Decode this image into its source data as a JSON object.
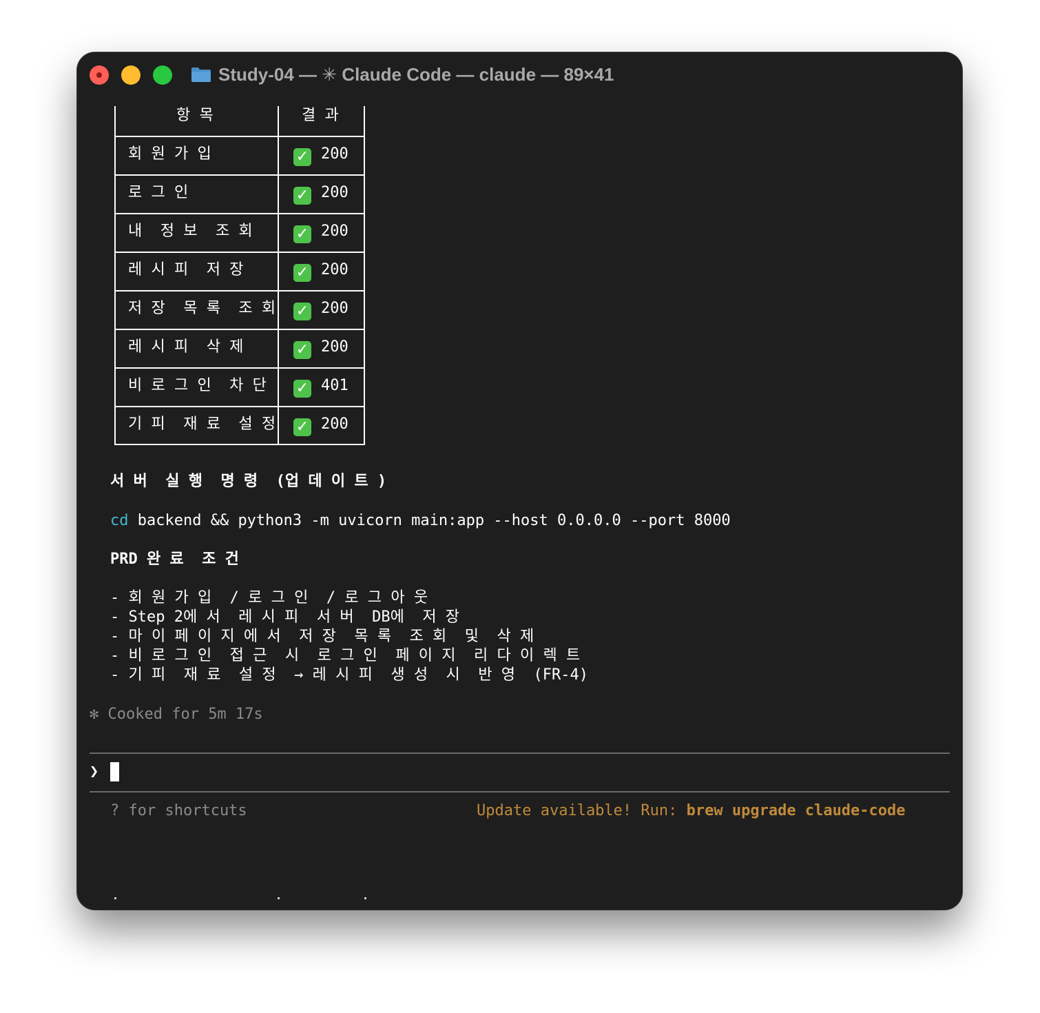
{
  "window": {
    "title_folder": "Study-04",
    "title_sep1": " — ",
    "title_spark": "✳",
    "title_app": " Claude Code",
    "title_sep2": " — ",
    "title_cmd": "claude",
    "title_sep3": " — ",
    "title_size": "89×41"
  },
  "table": {
    "headers": [
      "항 목",
      "결 과"
    ],
    "rows": [
      {
        "item": "회 원 가 입",
        "result": "200"
      },
      {
        "item": "로 그 인",
        "result": "200"
      },
      {
        "item": "내  정 보  조 회",
        "result": "200"
      },
      {
        "item": "레 시 피  저 장",
        "result": "200"
      },
      {
        "item": "저 장  목 록  조 회",
        "result": "200"
      },
      {
        "item": "레 시 피  삭 제",
        "result": "200"
      },
      {
        "item": "비 로 그 인  차 단",
        "result": "401"
      },
      {
        "item": "기 피  재 료  설 정",
        "result": "200"
      }
    ],
    "check_glyph": "✓"
  },
  "server": {
    "heading": "서 버  실 행  명 령  (업 데 이 트 )",
    "cmd_keyword": "cd",
    "cmd_rest": " backend && python3 -m uvicorn main:app --host 0.0.0.0 --port 8000"
  },
  "prd": {
    "heading": "PRD 완 료  조 건",
    "items": [
      "- 회 원 가 입  / 로 그 인  / 로 그 아 웃",
      "- Step 2에 서  레 시 피  서 버  DB에  저 장",
      "- 마 이 페 이 지 에 서  저 장  목 록  조 회  및  삭 제",
      "- 비 로 그 인  접 근  시  로 그 인  페 이 지  리 다 이 렉 트",
      "- 기 피  재 료  설 정  → 레 시 피  생 성  시  반 영  (FR-4)"
    ]
  },
  "status": {
    "spinner": "✻",
    "cooked": " Cooked for 5m 17s"
  },
  "prompt": {
    "symbol": "❯"
  },
  "footer": {
    "shortcuts": "? for shortcuts",
    "update_text": "Update available! Run: ",
    "update_cmd": "brew upgrade claude-code"
  }
}
